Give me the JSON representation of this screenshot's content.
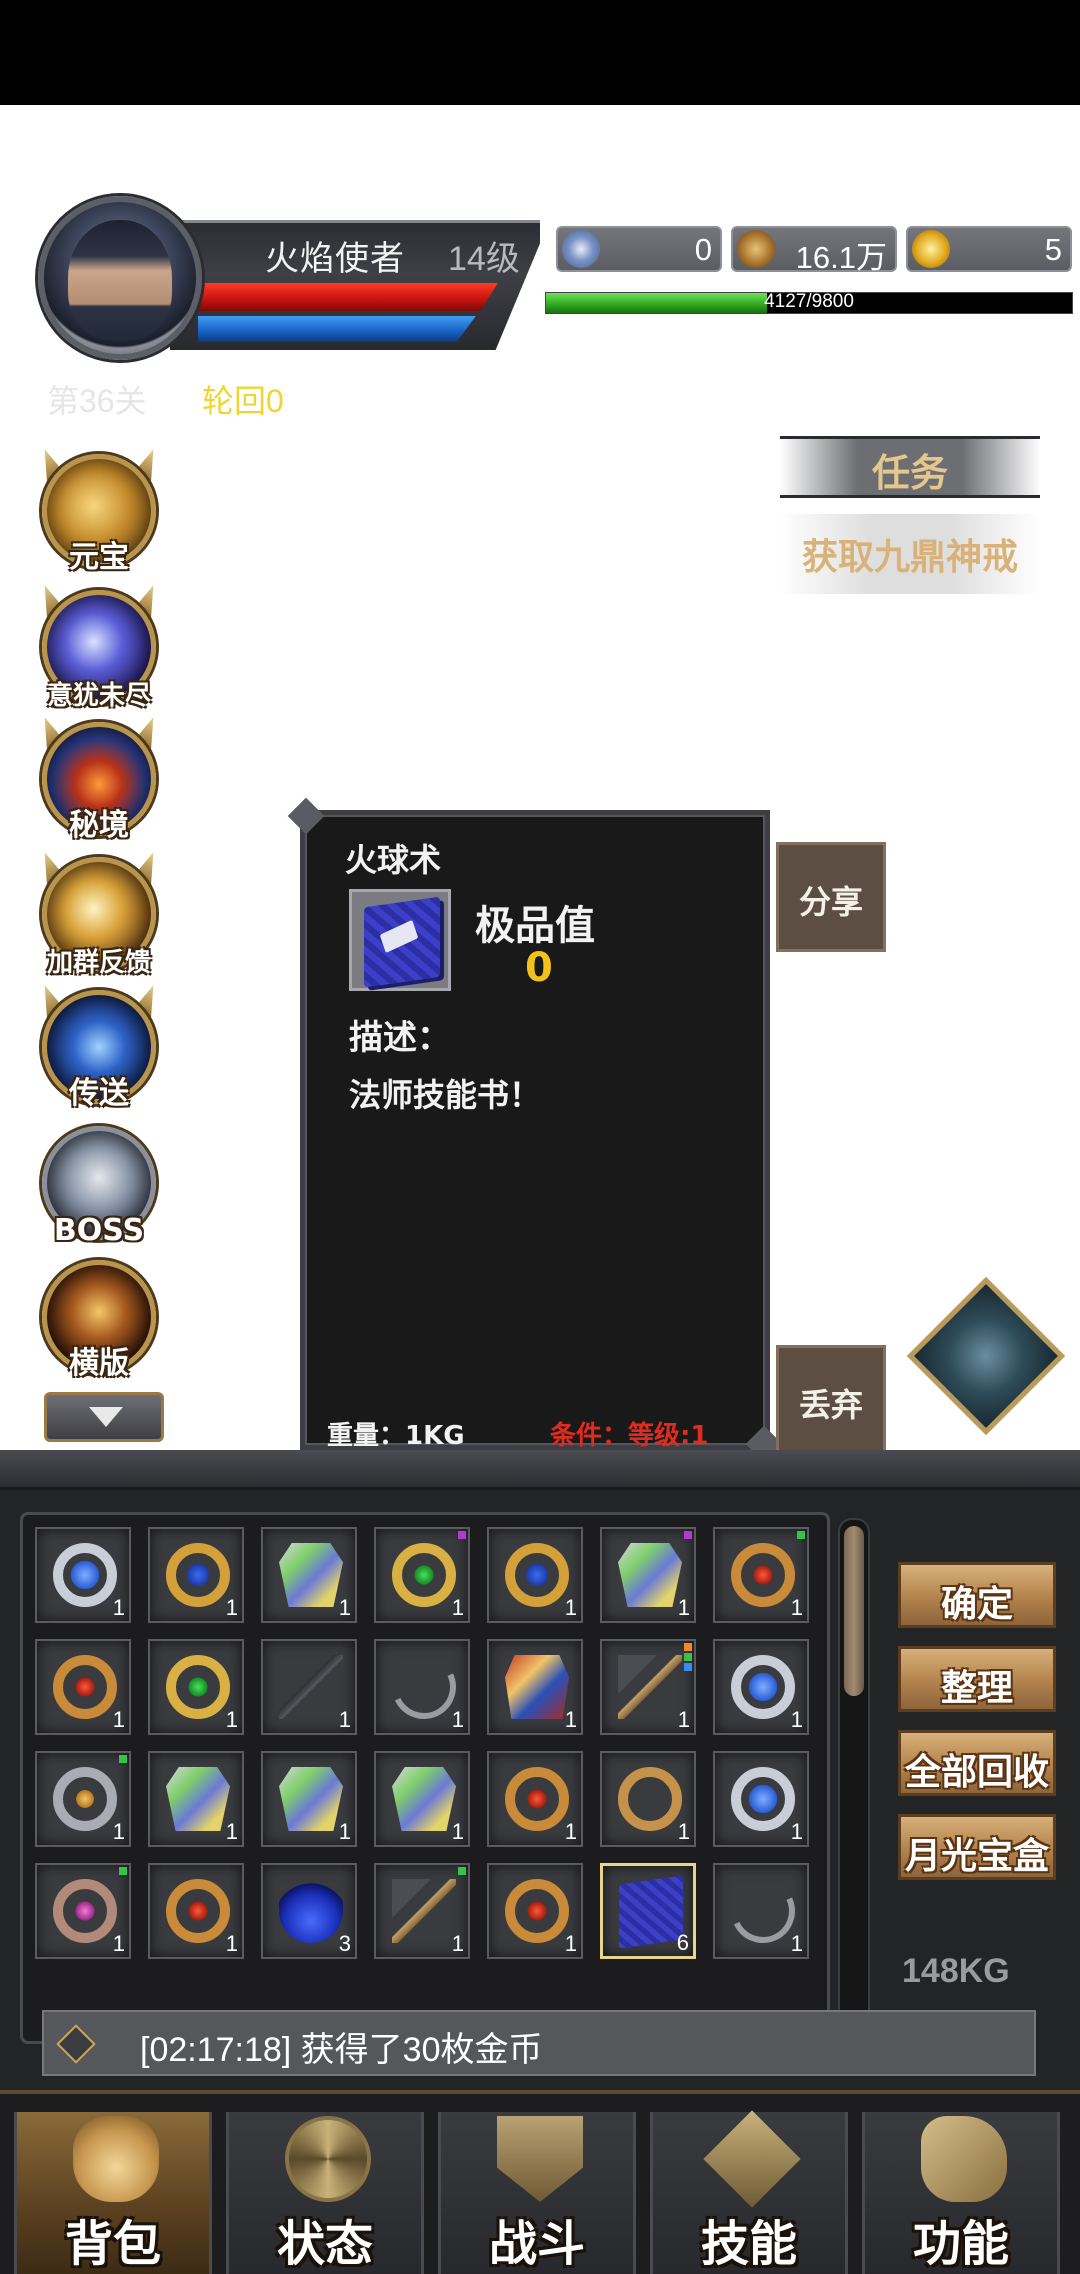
{
  "player": {
    "name": "火焰使者",
    "level": "14级",
    "hp_fraction": 1.0,
    "mp_fraction": 1.0
  },
  "currencies": [
    {
      "icon": "star-gem-icon",
      "value": "0"
    },
    {
      "icon": "copper-coin-icon",
      "value": "16.1万"
    },
    {
      "icon": "gold-ingot-icon",
      "value": "5"
    }
  ],
  "exp": {
    "text": "4127/9800",
    "fraction": 0.421
  },
  "stage": {
    "label": "第36关",
    "rebirth": "轮回0"
  },
  "side_menu": [
    {
      "label": "元宝",
      "icon": "gold-ingot-icon"
    },
    {
      "label": "意犹未尽",
      "icon": "crystal-ball-icon"
    },
    {
      "label": "秘境",
      "icon": "secret-realm-icon"
    },
    {
      "label": "加群反馈",
      "icon": "feedback-orb-icon"
    },
    {
      "label": "传送",
      "icon": "teleport-icon"
    },
    {
      "label": "BOSS",
      "icon": "boss-dragon-icon"
    },
    {
      "label": "横版",
      "icon": "landscape-mode-icon"
    }
  ],
  "task": {
    "title": "任务",
    "description": "获取九鼎神戒"
  },
  "tooltip": {
    "item_name": "火球术",
    "quality_label": "极品值",
    "quality_value": "0",
    "description_label": "描述：",
    "description": "法师技能书！",
    "weight": "重量：1KG",
    "requirement": "条件：等级:1"
  },
  "tooltip_actions": {
    "share": "分享",
    "drop": "丢弃"
  },
  "inventory": {
    "slots": [
      {
        "item": "blue-gem-silver-ring",
        "count": "1"
      },
      {
        "item": "gold-sapphire-ring",
        "count": "1"
      },
      {
        "item": "jeweled-armor",
        "count": "1"
      },
      {
        "item": "green-gem-silver-ring",
        "count": "1",
        "badge": "purple"
      },
      {
        "item": "gold-sapphire-ring",
        "count": "1"
      },
      {
        "item": "jeweled-armor",
        "count": "1",
        "badge": "purple"
      },
      {
        "item": "ruby-gold-ring",
        "count": "1",
        "badge": "green"
      },
      {
        "item": "ruby-gold-ring",
        "count": "1"
      },
      {
        "item": "emerald-gold-ring",
        "count": "1"
      },
      {
        "item": "dark-staff",
        "count": "1"
      },
      {
        "item": "bone-bow",
        "count": "1"
      },
      {
        "item": "crimson-chestplate",
        "count": "1"
      },
      {
        "item": "war-hammer",
        "count": "1",
        "badge": "multi"
      },
      {
        "item": "blue-gem-silver-ring",
        "count": "1"
      },
      {
        "item": "topaz-silver-ring",
        "count": "1",
        "badge": "green"
      },
      {
        "item": "jeweled-armor",
        "count": "1"
      },
      {
        "item": "jeweled-armor",
        "count": "1"
      },
      {
        "item": "jeweled-armor",
        "count": "1"
      },
      {
        "item": "ruby-gold-ring",
        "count": "1"
      },
      {
        "item": "plain-gold-ring",
        "count": "1"
      },
      {
        "item": "blue-gem-silver-ring",
        "count": "1"
      },
      {
        "item": "pink-gem-ring",
        "count": "1",
        "badge": "green"
      },
      {
        "item": "ruby-gold-ring",
        "count": "1"
      },
      {
        "item": "mana-potion",
        "count": "3"
      },
      {
        "item": "war-hammer",
        "count": "1",
        "badge": "green"
      },
      {
        "item": "ruby-gold-ring",
        "count": "1"
      },
      {
        "item": "skill-book",
        "count": "6",
        "selected": true
      },
      {
        "item": "bone-bow",
        "count": "1"
      }
    ],
    "scroll_fraction": 0.0,
    "weight": "148KG"
  },
  "inventory_actions": {
    "confirm": "确定",
    "sort": "整理",
    "recycle_all": "全部回收",
    "moonlight_box": "月光宝盒"
  },
  "message": "[02:17:18] 获得了30枚金币",
  "nav": [
    {
      "label": "背包",
      "icon": "bag-icon",
      "active": true
    },
    {
      "label": "状态",
      "icon": "status-swirl-icon",
      "active": false
    },
    {
      "label": "战斗",
      "icon": "battle-shield-icon",
      "active": false
    },
    {
      "label": "技能",
      "icon": "skill-diamond-icon",
      "active": false
    },
    {
      "label": "功能",
      "icon": "function-hand-icon",
      "active": false
    }
  ]
}
